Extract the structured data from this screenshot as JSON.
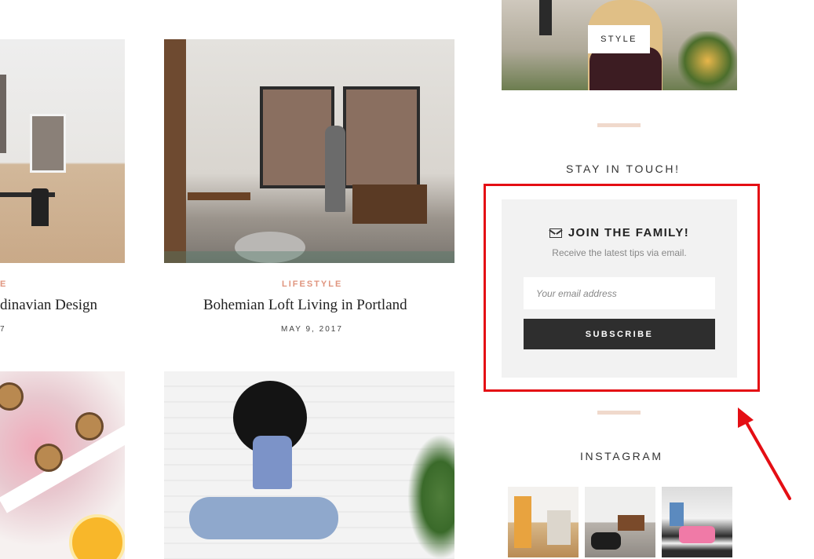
{
  "posts": [
    {
      "category": "E",
      "title": "dinavian Design",
      "date": "7"
    },
    {
      "category": "LIFESTYLE",
      "title": "Bohemian Loft Living in Portland",
      "date": "MAY 9, 2017"
    }
  ],
  "sidebar": {
    "style_badge": "STYLE",
    "stay_in_touch": "STAY IN TOUCH!",
    "newsletter": {
      "title": "JOIN THE FAMILY!",
      "subtitle": "Receive the latest tips via email.",
      "email_placeholder": "Your email address",
      "button_label": "SUBSCRIBE",
      "icon": "envelope-icon"
    },
    "instagram_title": "INSTAGRAM"
  },
  "colors": {
    "category": "#e0957f",
    "divider": "#f0d9cc",
    "highlight": "#e40e14",
    "button": "#2e2e2e",
    "newsletter_bg": "#f2f2f2"
  }
}
